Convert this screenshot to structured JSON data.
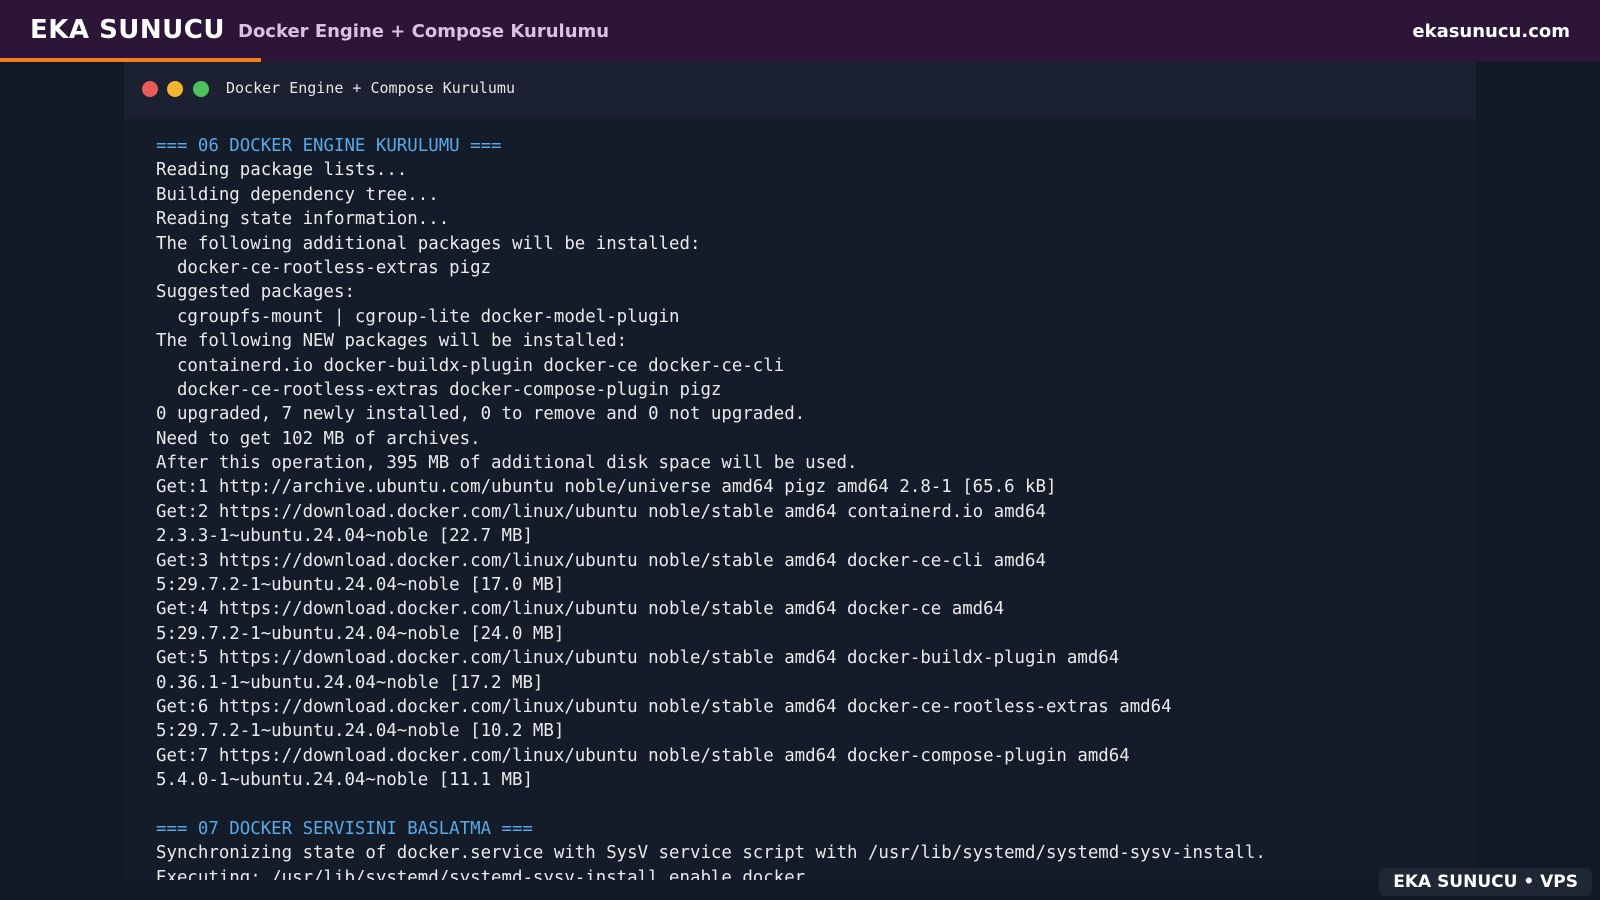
{
  "header": {
    "brand": "EKA SUNUCU",
    "subtitle": "Docker Engine + Compose Kurulumu",
    "site": "ekasunucu.com",
    "accent_color": "#f07f22"
  },
  "window": {
    "title": "Docker Engine + Compose Kurulumu"
  },
  "terminal": {
    "lines": [
      {
        "text": "=== 06 DOCKER ENGINE KURULUMU ===",
        "kind": "head"
      },
      {
        "text": "Reading package lists...",
        "kind": "out"
      },
      {
        "text": "Building dependency tree...",
        "kind": "out"
      },
      {
        "text": "Reading state information...",
        "kind": "out"
      },
      {
        "text": "The following additional packages will be installed:",
        "kind": "out"
      },
      {
        "text": "  docker-ce-rootless-extras pigz",
        "kind": "out"
      },
      {
        "text": "Suggested packages:",
        "kind": "out"
      },
      {
        "text": "  cgroupfs-mount | cgroup-lite docker-model-plugin",
        "kind": "out"
      },
      {
        "text": "The following NEW packages will be installed:",
        "kind": "out"
      },
      {
        "text": "  containerd.io docker-buildx-plugin docker-ce docker-ce-cli",
        "kind": "out"
      },
      {
        "text": "  docker-ce-rootless-extras docker-compose-plugin pigz",
        "kind": "out"
      },
      {
        "text": "0 upgraded, 7 newly installed, 0 to remove and 0 not upgraded.",
        "kind": "out"
      },
      {
        "text": "Need to get 102 MB of archives.",
        "kind": "out"
      },
      {
        "text": "After this operation, 395 MB of additional disk space will be used.",
        "kind": "out"
      },
      {
        "text": "Get:1 http://archive.ubuntu.com/ubuntu noble/universe amd64 pigz amd64 2.8-1 [65.6 kB]",
        "kind": "out"
      },
      {
        "text": "Get:2 https://download.docker.com/linux/ubuntu noble/stable amd64 containerd.io amd64",
        "kind": "out"
      },
      {
        "text": "2.3.3-1~ubuntu.24.04~noble [22.7 MB]",
        "kind": "out"
      },
      {
        "text": "Get:3 https://download.docker.com/linux/ubuntu noble/stable amd64 docker-ce-cli amd64",
        "kind": "out"
      },
      {
        "text": "5:29.7.2-1~ubuntu.24.04~noble [17.0 MB]",
        "kind": "out"
      },
      {
        "text": "Get:4 https://download.docker.com/linux/ubuntu noble/stable amd64 docker-ce amd64",
        "kind": "out"
      },
      {
        "text": "5:29.7.2-1~ubuntu.24.04~noble [24.0 MB]",
        "kind": "out"
      },
      {
        "text": "Get:5 https://download.docker.com/linux/ubuntu noble/stable amd64 docker-buildx-plugin amd64",
        "kind": "out"
      },
      {
        "text": "0.36.1-1~ubuntu.24.04~noble [17.2 MB]",
        "kind": "out"
      },
      {
        "text": "Get:6 https://download.docker.com/linux/ubuntu noble/stable amd64 docker-ce-rootless-extras amd64",
        "kind": "out"
      },
      {
        "text": "5:29.7.2-1~ubuntu.24.04~noble [10.2 MB]",
        "kind": "out"
      },
      {
        "text": "Get:7 https://download.docker.com/linux/ubuntu noble/stable amd64 docker-compose-plugin amd64",
        "kind": "out"
      },
      {
        "text": "5.4.0-1~ubuntu.24.04~noble [11.1 MB]",
        "kind": "out"
      },
      {
        "text": "",
        "kind": "out"
      },
      {
        "text": "=== 07 DOCKER SERVISINI BASLATMA ===",
        "kind": "head"
      },
      {
        "text": "Synchronizing state of docker.service with SysV service script with /usr/lib/systemd/systemd-sysv-install.",
        "kind": "out"
      },
      {
        "text": "Executing: /usr/lib/systemd/systemd-sysv-install enable docker",
        "kind": "out"
      }
    ]
  },
  "badge": {
    "text": "EKA SUNUCU • VPS"
  }
}
